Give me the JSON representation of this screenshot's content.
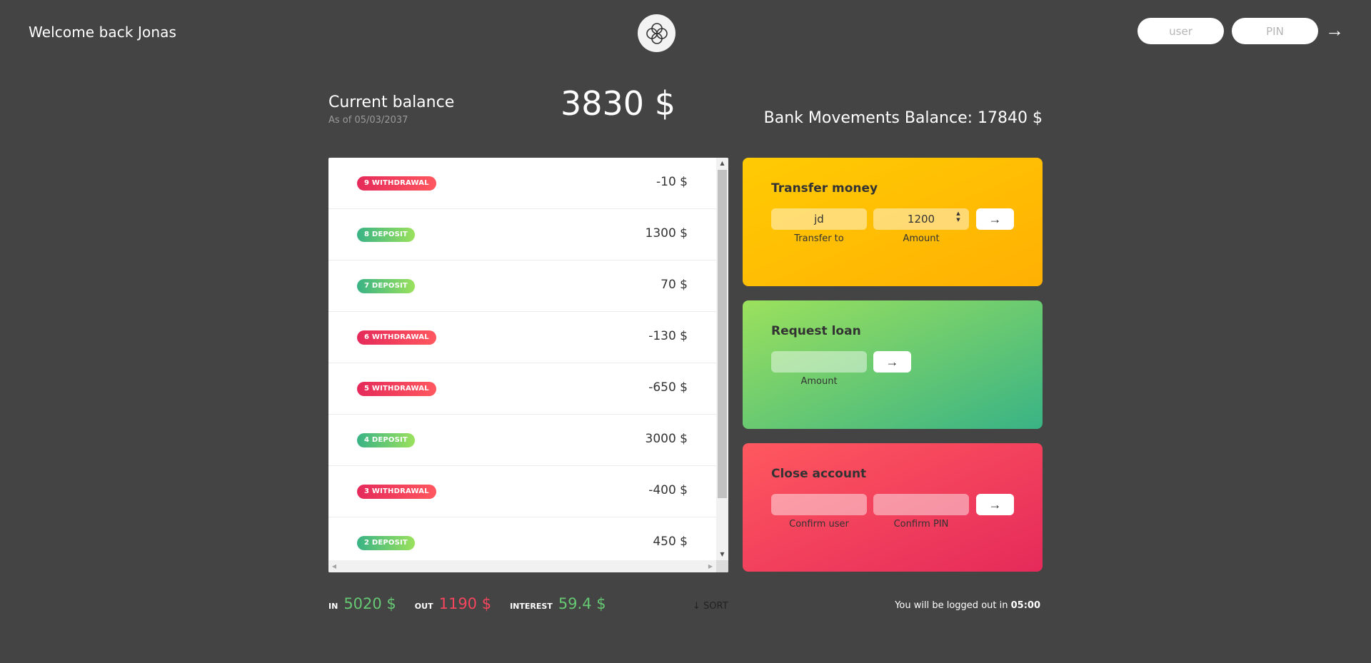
{
  "nav": {
    "welcome": "Welcome back Jonas",
    "user_placeholder": "user",
    "pin_placeholder": "PIN",
    "login_icon": "arrow-right-icon"
  },
  "balance": {
    "label": "Current balance",
    "date_prefix": "As of ",
    "date": "05/03/2037",
    "value": "3830 $",
    "bank_movements": "Bank Movements Balance: 17840 $"
  },
  "movements": [
    {
      "label": "9 withdrawal",
      "type": "withdrawal",
      "value": "-10 $"
    },
    {
      "label": "8 deposit",
      "type": "deposit",
      "value": "1300 $"
    },
    {
      "label": "7 deposit",
      "type": "deposit",
      "value": "70 $"
    },
    {
      "label": "6 withdrawal",
      "type": "withdrawal",
      "value": "-130 $"
    },
    {
      "label": "5 withdrawal",
      "type": "withdrawal",
      "value": "-650 $"
    },
    {
      "label": "4 deposit",
      "type": "deposit",
      "value": "3000 $"
    },
    {
      "label": "3 withdrawal",
      "type": "withdrawal",
      "value": "-400 $"
    },
    {
      "label": "2 deposit",
      "type": "deposit",
      "value": "450 $"
    }
  ],
  "operations": {
    "transfer": {
      "title": "Transfer money",
      "to_value": "jd",
      "amount_value": "1200",
      "to_label": "Transfer to",
      "amount_label": "Amount",
      "button": "→"
    },
    "loan": {
      "title": "Request loan",
      "amount_value": "",
      "amount_label": "Amount",
      "button": "→"
    },
    "close": {
      "title": "Close account",
      "user_value": "",
      "pin_value": "",
      "user_label": "Confirm user",
      "pin_label": "Confirm PIN",
      "button": "→"
    }
  },
  "summary": {
    "in_label": "In",
    "in_value": "5020 $",
    "out_label": "Out",
    "out_value": "1190 $",
    "interest_label": "Interest",
    "interest_value": "59.4 $",
    "sort_label": "↓ SORT"
  },
  "logout": {
    "text": "You will be logged out in ",
    "time": "05:00"
  },
  "colors": {
    "background": "#444444",
    "withdrawal": "#e52a5a",
    "deposit": "#39b385",
    "transfer": "#ffb003",
    "loan": "#9be15d",
    "close": "#ff585f",
    "in": "#66c873",
    "out": "#f5465d"
  }
}
